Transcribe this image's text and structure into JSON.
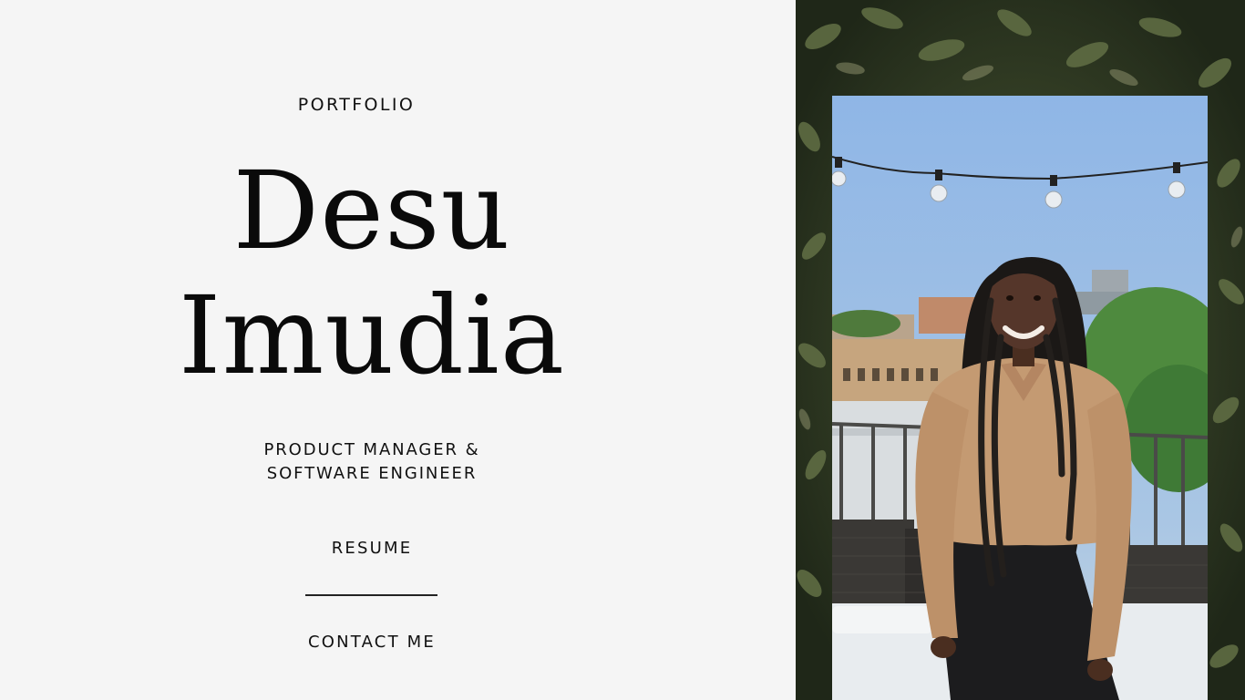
{
  "hero": {
    "eyebrow": "PORTFOLIO",
    "first_name": "Desu",
    "last_name": "Imudia",
    "role_line_1": "PRODUCT MANAGER &",
    "role_line_2": "SOFTWARE ENGINEER"
  },
  "nav": {
    "resume_label": "RESUME",
    "contact_label": "CONTACT ME"
  },
  "photo": {
    "subject": "portrait-photo",
    "sky_color": "#9fc1e8",
    "foliage_color": "#3b4a2c",
    "sweater_color": "#c49a72"
  }
}
